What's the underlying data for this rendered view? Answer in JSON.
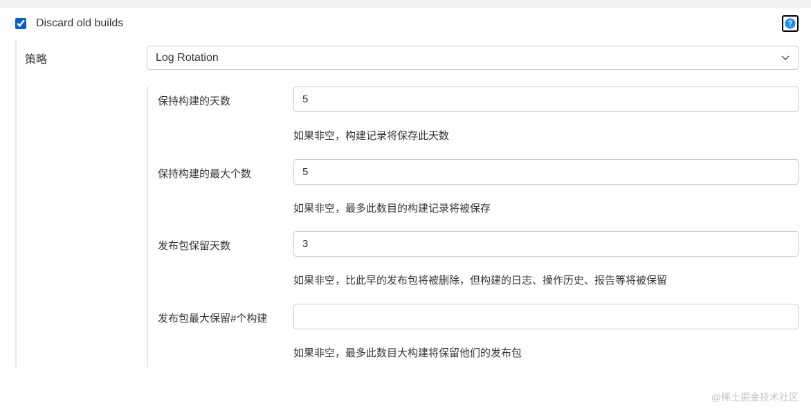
{
  "header": {
    "checkbox_label": "Discard old builds",
    "checkbox_checked": true
  },
  "strategy": {
    "label": "策略",
    "selected": "Log Rotation"
  },
  "fields": [
    {
      "label": "保持构建的天数",
      "value": "5",
      "help": "如果非空，构建记录将保存此天数"
    },
    {
      "label": "保持构建的最大个数",
      "value": "5",
      "help": "如果非空，最多此数目的构建记录将被保存"
    },
    {
      "label": "发布包保留天数",
      "value": "3",
      "help": "如果非空，比此早的发布包将被删除，但构建的日志、操作历史、报告等将被保留"
    },
    {
      "label": "发布包最大保留#个构建",
      "value": "",
      "help": "如果非空，最多此数目大构建将保留他们的发布包"
    }
  ],
  "watermark": "@稀土掘金技术社区"
}
